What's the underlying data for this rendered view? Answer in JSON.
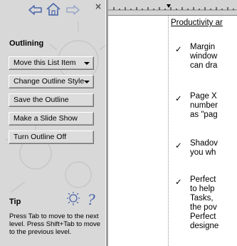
{
  "panel": {
    "section_title": "Outlining",
    "buttons": [
      {
        "label": "Move this List Item",
        "has_dropdown": true
      },
      {
        "label": "Change Outline Style",
        "has_dropdown": true
      },
      {
        "label": "Save the Outline",
        "has_dropdown": false
      },
      {
        "label": "Make a Slide Show",
        "has_dropdown": false
      },
      {
        "label": "Turn Outline Off",
        "has_dropdown": false
      }
    ],
    "tip": {
      "title": "Tip",
      "text": "Press Tab to move to the next level. Press Shift+Tab to move to the previous level."
    },
    "nav_icons": [
      "back-arrow-icon",
      "home-icon",
      "forward-arrow-icon",
      "close-icon"
    ],
    "tip_icons": [
      "lightbulb-icon",
      "help-question-icon"
    ]
  },
  "document": {
    "heading": "Productivity ar",
    "items": [
      {
        "bullet": "✓",
        "lines": [
          "Margin",
          "window",
          "can dra"
        ]
      },
      {
        "bullet": "✓",
        "lines": [
          "Page X",
          "number",
          "as \"pag"
        ]
      },
      {
        "bullet": "✓",
        "lines": [
          "Shadov",
          "you wh"
        ]
      },
      {
        "bullet": "✓",
        "lines": [
          "Perfect",
          "to help",
          "Tasks, ",
          "the pov",
          "Perfect",
          "designe"
        ]
      }
    ]
  },
  "colors": {
    "panel_bg": "#d8d8d8",
    "button_face": "#dcdcdc",
    "ruler_bg": "#d4d4d4",
    "icon_blue": "#4a66a8"
  }
}
